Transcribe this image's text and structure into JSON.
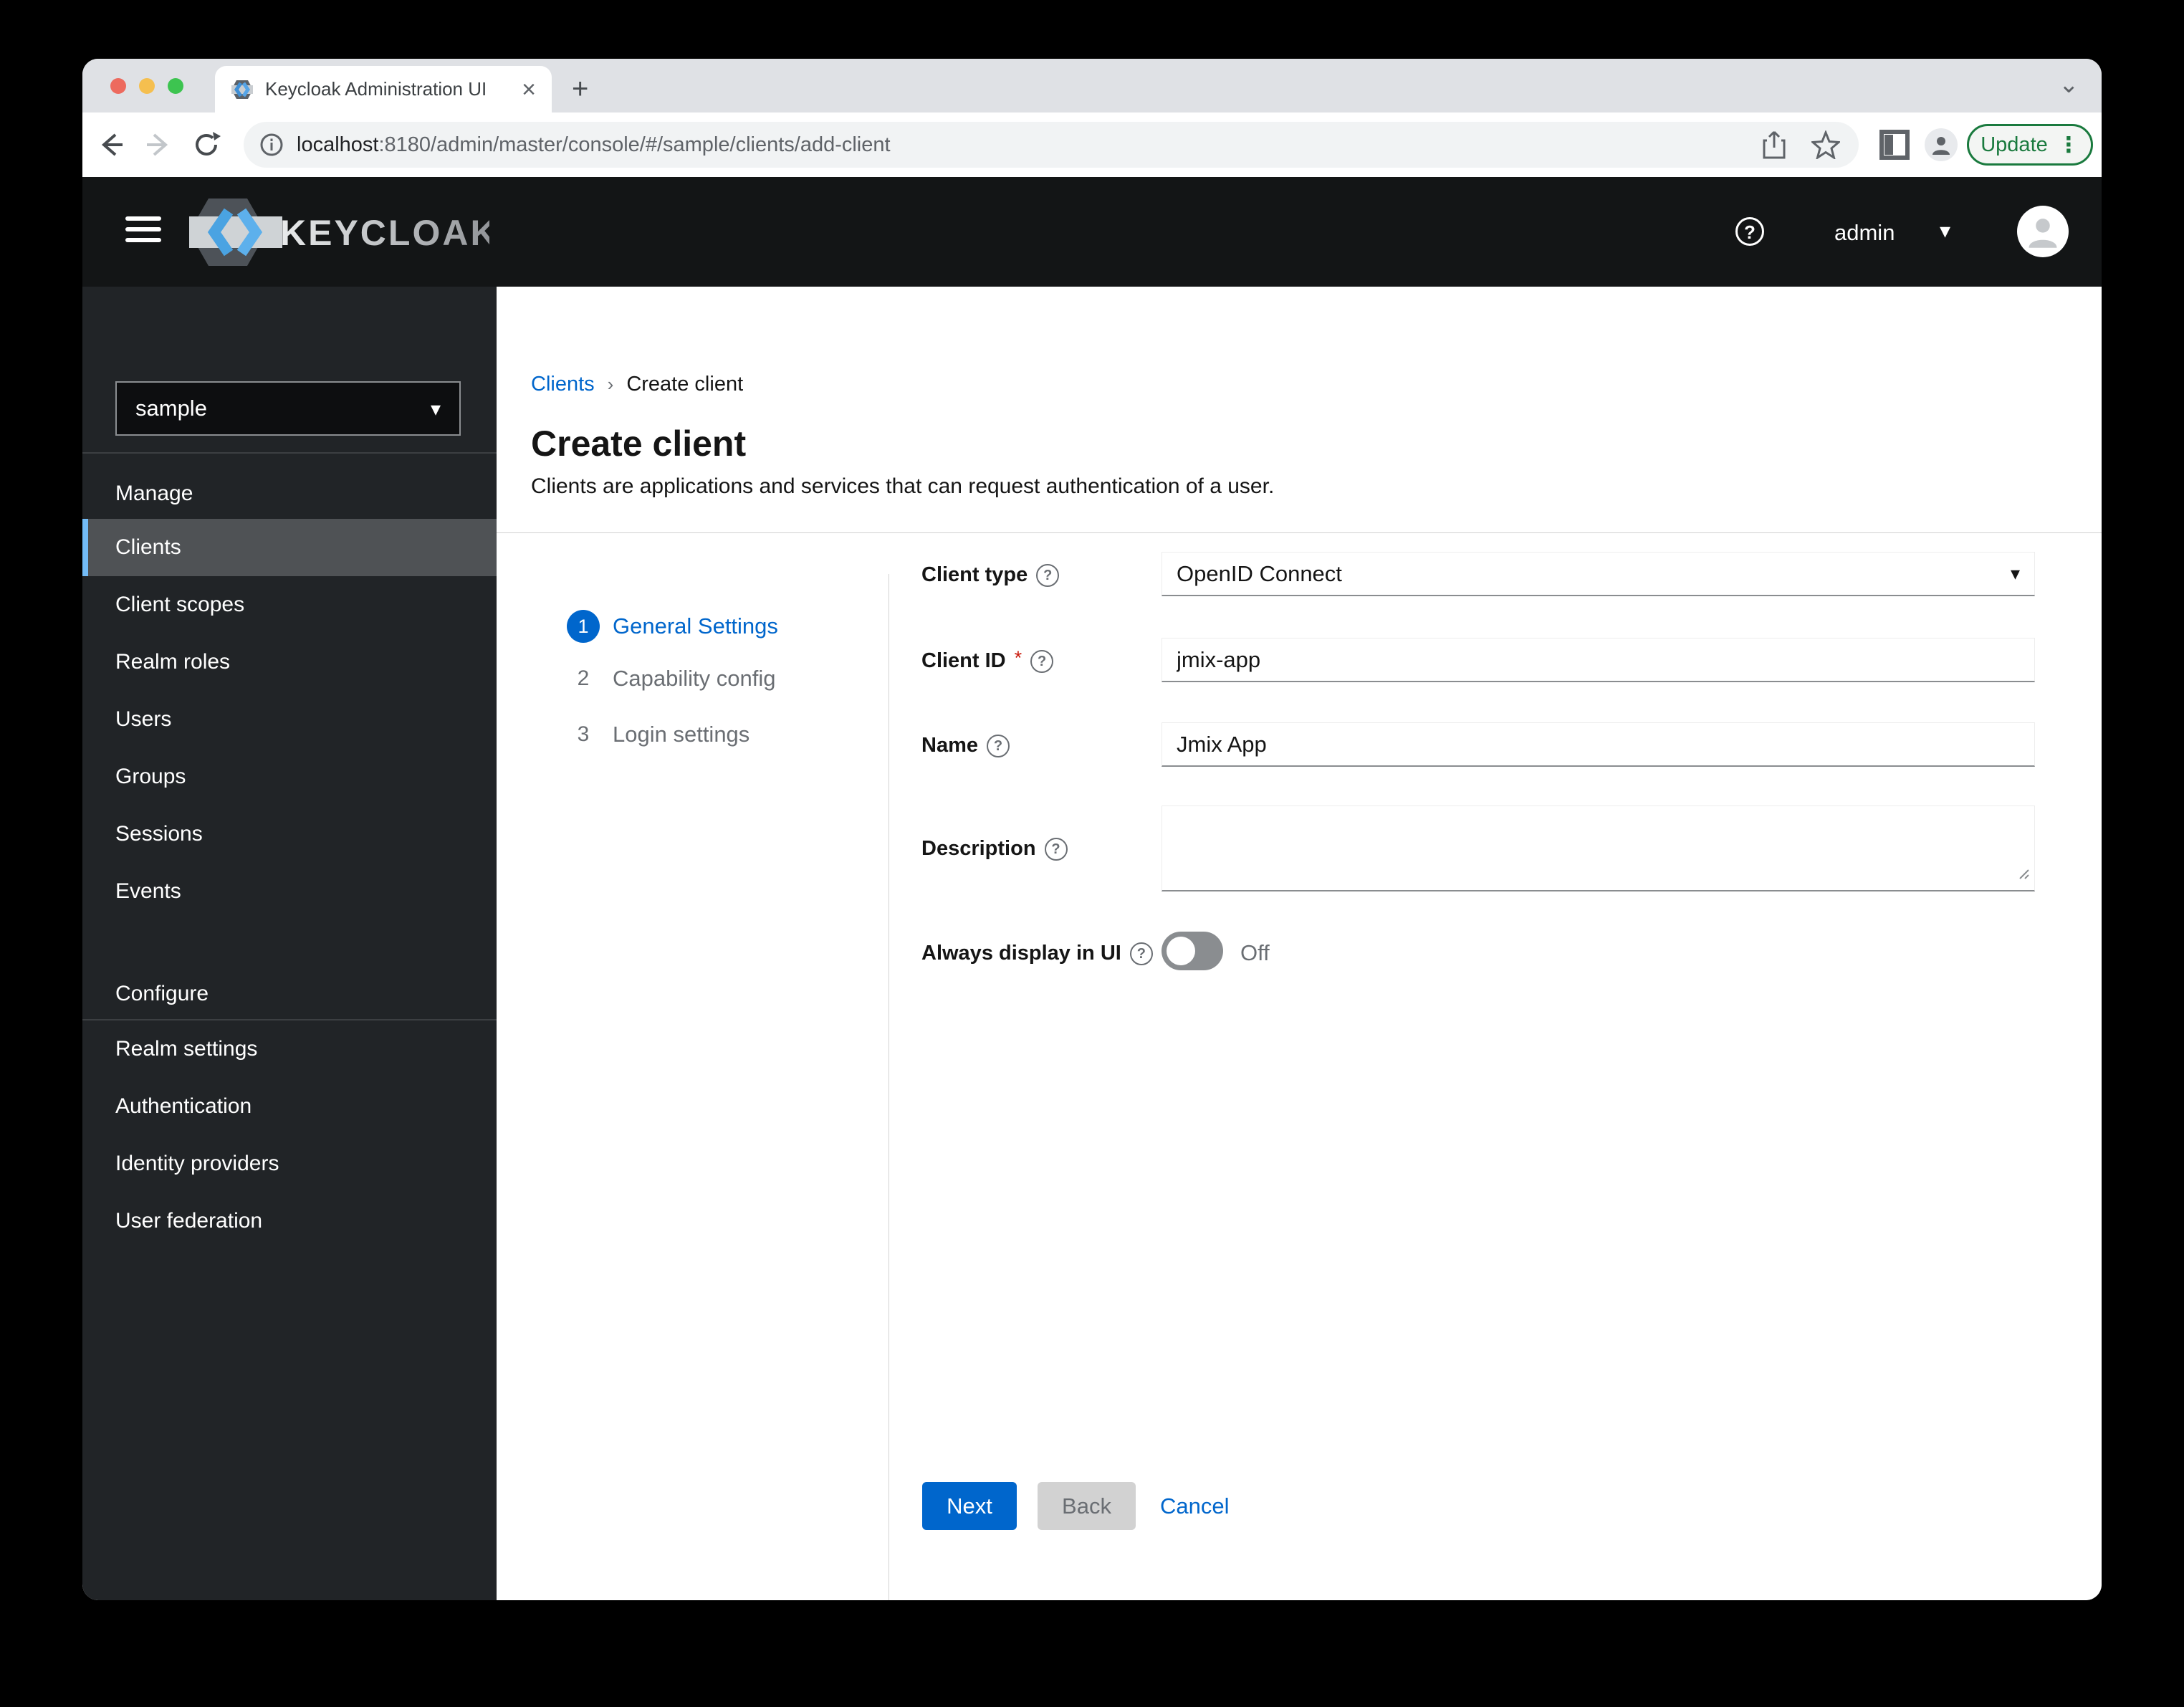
{
  "browser": {
    "tab_title": "Keycloak Administration UI",
    "url_host": "localhost",
    "url_rest": ":8180/admin/master/console/#/sample/clients/add-client",
    "update_label": "Update"
  },
  "icons": {
    "close": "×",
    "new_tab": "+",
    "tab_overflow": "⌄",
    "caret_down": "▾",
    "breadcrumb_sep": "›",
    "help": "?",
    "ellipsis_v": "⋮"
  },
  "masthead": {
    "brand": "KEYCLOAK",
    "user": "admin"
  },
  "sidebar": {
    "realm": "sample",
    "sections": [
      {
        "title": "Manage",
        "items": [
          "Clients",
          "Client scopes",
          "Realm roles",
          "Users",
          "Groups",
          "Sessions",
          "Events"
        ]
      },
      {
        "title": "Configure",
        "items": [
          "Realm settings",
          "Authentication",
          "Identity providers",
          "User federation"
        ]
      }
    ],
    "selected": "Clients"
  },
  "breadcrumb": {
    "link": "Clients",
    "current": "Create client"
  },
  "page": {
    "title": "Create client",
    "subtitle": "Clients are applications and services that can request authentication of a user."
  },
  "wizard": {
    "steps": [
      {
        "num": "1",
        "label": "General Settings"
      },
      {
        "num": "2",
        "label": "Capability config"
      },
      {
        "num": "3",
        "label": "Login settings"
      }
    ]
  },
  "form": {
    "client_type": {
      "label": "Client type",
      "value": "OpenID Connect"
    },
    "client_id": {
      "label": "Client ID",
      "required": "*",
      "value": "jmix-app"
    },
    "name": {
      "label": "Name",
      "value": "Jmix App"
    },
    "description": {
      "label": "Description",
      "value": ""
    },
    "always_display": {
      "label": "Always display in UI",
      "state": "Off"
    }
  },
  "actions": {
    "next": "Next",
    "back": "Back",
    "cancel": "Cancel"
  },
  "colors": {
    "accent_blue": "#0066cc",
    "nav_accent": "#73bcf7",
    "chrome_green": "#1a7a3e"
  }
}
